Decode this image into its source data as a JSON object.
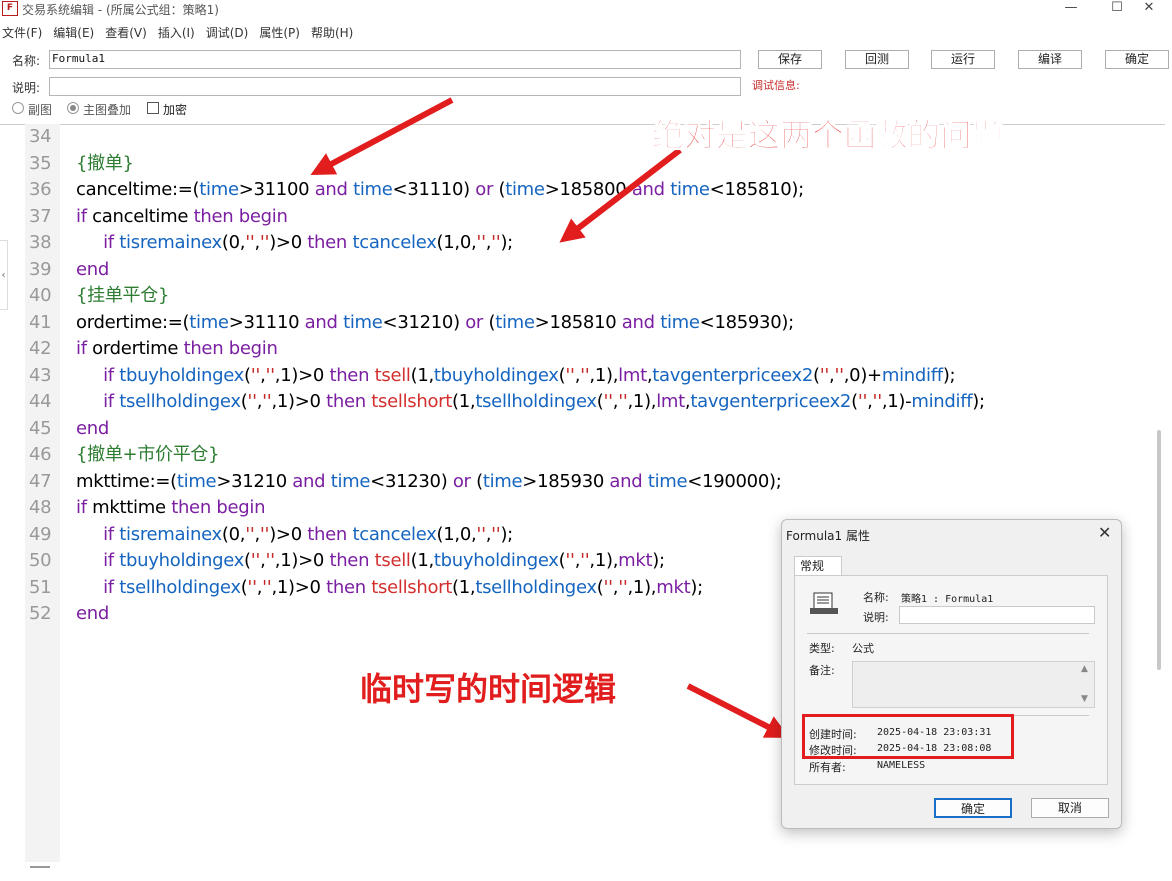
{
  "window": {
    "title": "交易系统编辑 - (所属公式组：策略1)",
    "icon_text": "F",
    "minimize": "—",
    "maximize": "☐",
    "close": "✕"
  },
  "menu": [
    "文件(F)",
    "编辑(E)",
    "查看(V)",
    "插入(I)",
    "调试(D)",
    "属性(P)",
    "帮助(H)"
  ],
  "form": {
    "name_label": "名称:",
    "name_value": "Formula1",
    "desc_label": "说明:",
    "desc_value": "",
    "debug_label": "调试信息:"
  },
  "toolbar": [
    "保存",
    "回测",
    "运行",
    "编译",
    "确定"
  ],
  "options": {
    "sub_chart": "副图",
    "main_overlay": "主图叠加",
    "encrypt": "加密",
    "selected": "主图叠加"
  },
  "code_lines": [
    {
      "num": "34",
      "segs": []
    },
    {
      "num": "35",
      "segs": [
        {
          "t": "{撤单}",
          "c": "gr"
        }
      ]
    },
    {
      "num": "36",
      "segs": [
        {
          "t": "canceltime:=("
        },
        {
          "t": "time",
          "c": "fn"
        },
        {
          "t": ">31100 "
        },
        {
          "t": "and",
          "c": "kw"
        },
        {
          "t": " "
        },
        {
          "t": "time",
          "c": "fn"
        },
        {
          "t": "<31110) "
        },
        {
          "t": "or",
          "c": "kw"
        },
        {
          "t": " ("
        },
        {
          "t": "time",
          "c": "fn"
        },
        {
          "t": ">185800 "
        },
        {
          "t": "and",
          "c": "kw"
        },
        {
          "t": " "
        },
        {
          "t": "time",
          "c": "fn"
        },
        {
          "t": "<185810);"
        }
      ]
    },
    {
      "num": "37",
      "segs": [
        {
          "t": "if",
          "c": "kw"
        },
        {
          "t": " canceltime "
        },
        {
          "t": "then begin",
          "c": "kw"
        }
      ]
    },
    {
      "num": "38",
      "segs": [
        {
          "t": "     "
        },
        {
          "t": "if",
          "c": "kw"
        },
        {
          "t": " "
        },
        {
          "t": "tisremainex",
          "c": "fn"
        },
        {
          "t": "(0,"
        },
        {
          "t": "''",
          "c": "st"
        },
        {
          "t": ","
        },
        {
          "t": "''",
          "c": "st"
        },
        {
          "t": ")>0 "
        },
        {
          "t": "then",
          "c": "kw"
        },
        {
          "t": " "
        },
        {
          "t": "tcancelex",
          "c": "fn"
        },
        {
          "t": "(1,0,"
        },
        {
          "t": "''",
          "c": "st"
        },
        {
          "t": ","
        },
        {
          "t": "''",
          "c": "st"
        },
        {
          "t": ");"
        }
      ]
    },
    {
      "num": "39",
      "segs": [
        {
          "t": "end",
          "c": "kw"
        }
      ]
    },
    {
      "num": "40",
      "segs": [
        {
          "t": "{挂单平仓}",
          "c": "gr"
        }
      ]
    },
    {
      "num": "41",
      "segs": [
        {
          "t": "ordertime:=("
        },
        {
          "t": "time",
          "c": "fn"
        },
        {
          "t": ">31110 "
        },
        {
          "t": "and",
          "c": "kw"
        },
        {
          "t": " "
        },
        {
          "t": "time",
          "c": "fn"
        },
        {
          "t": "<31210) "
        },
        {
          "t": "or",
          "c": "kw"
        },
        {
          "t": " ("
        },
        {
          "t": "time",
          "c": "fn"
        },
        {
          "t": ">185810 "
        },
        {
          "t": "and",
          "c": "kw"
        },
        {
          "t": " "
        },
        {
          "t": "time",
          "c": "fn"
        },
        {
          "t": "<185930);"
        }
      ]
    },
    {
      "num": "42",
      "segs": [
        {
          "t": "if",
          "c": "kw"
        },
        {
          "t": " ordertime "
        },
        {
          "t": "then begin",
          "c": "kw"
        }
      ]
    },
    {
      "num": "43",
      "segs": [
        {
          "t": "     "
        },
        {
          "t": "if",
          "c": "kw"
        },
        {
          "t": " "
        },
        {
          "t": "tbuyholdingex",
          "c": "fn"
        },
        {
          "t": "("
        },
        {
          "t": "''",
          "c": "st"
        },
        {
          "t": ","
        },
        {
          "t": "''",
          "c": "st"
        },
        {
          "t": ",1)>0 "
        },
        {
          "t": "then",
          "c": "kw"
        },
        {
          "t": " "
        },
        {
          "t": "tsell",
          "c": "rd"
        },
        {
          "t": "(1,"
        },
        {
          "t": "tbuyholdingex",
          "c": "fn"
        },
        {
          "t": "("
        },
        {
          "t": "''",
          "c": "st"
        },
        {
          "t": ","
        },
        {
          "t": "''",
          "c": "st"
        },
        {
          "t": ",1),"
        },
        {
          "t": "lmt",
          "c": "kw"
        },
        {
          "t": ","
        },
        {
          "t": "tavgenterpriceex2",
          "c": "fn"
        },
        {
          "t": "("
        },
        {
          "t": "''",
          "c": "st"
        },
        {
          "t": ","
        },
        {
          "t": "''",
          "c": "st"
        },
        {
          "t": ",0)+"
        },
        {
          "t": "mindiff",
          "c": "fn"
        },
        {
          "t": ");"
        }
      ]
    },
    {
      "num": "44",
      "segs": [
        {
          "t": "     "
        },
        {
          "t": "if",
          "c": "kw"
        },
        {
          "t": " "
        },
        {
          "t": "tsellholdingex",
          "c": "fn"
        },
        {
          "t": "("
        },
        {
          "t": "''",
          "c": "st"
        },
        {
          "t": ","
        },
        {
          "t": "''",
          "c": "st"
        },
        {
          "t": ",1)>0 "
        },
        {
          "t": "then",
          "c": "kw"
        },
        {
          "t": " "
        },
        {
          "t": "tsellshort",
          "c": "rd"
        },
        {
          "t": "(1,"
        },
        {
          "t": "tsellholdingex",
          "c": "fn"
        },
        {
          "t": "("
        },
        {
          "t": "''",
          "c": "st"
        },
        {
          "t": ","
        },
        {
          "t": "''",
          "c": "st"
        },
        {
          "t": ",1),"
        },
        {
          "t": "lmt",
          "c": "kw"
        },
        {
          "t": ","
        },
        {
          "t": "tavgenterpriceex2",
          "c": "fn"
        },
        {
          "t": "("
        },
        {
          "t": "''",
          "c": "st"
        },
        {
          "t": ","
        },
        {
          "t": "''",
          "c": "st"
        },
        {
          "t": ",1)-"
        },
        {
          "t": "mindiff",
          "c": "fn"
        },
        {
          "t": ");"
        }
      ]
    },
    {
      "num": "45",
      "segs": [
        {
          "t": "end",
          "c": "kw"
        }
      ]
    },
    {
      "num": "46",
      "segs": [
        {
          "t": "{撤单+市价平仓}",
          "c": "gr"
        }
      ]
    },
    {
      "num": "47",
      "segs": [
        {
          "t": "mkttime:=("
        },
        {
          "t": "time",
          "c": "fn"
        },
        {
          "t": ">31210 "
        },
        {
          "t": "and",
          "c": "kw"
        },
        {
          "t": " "
        },
        {
          "t": "time",
          "c": "fn"
        },
        {
          "t": "<31230) "
        },
        {
          "t": "or",
          "c": "kw"
        },
        {
          "t": " ("
        },
        {
          "t": "time",
          "c": "fn"
        },
        {
          "t": ">185930 "
        },
        {
          "t": "and",
          "c": "kw"
        },
        {
          "t": " "
        },
        {
          "t": "time",
          "c": "fn"
        },
        {
          "t": "<190000);"
        }
      ]
    },
    {
      "num": "48",
      "segs": [
        {
          "t": "if",
          "c": "kw"
        },
        {
          "t": " mkttime "
        },
        {
          "t": "then begin",
          "c": "kw"
        }
      ]
    },
    {
      "num": "49",
      "segs": [
        {
          "t": "     "
        },
        {
          "t": "if",
          "c": "kw"
        },
        {
          "t": " "
        },
        {
          "t": "tisremainex",
          "c": "fn"
        },
        {
          "t": "(0,"
        },
        {
          "t": "''",
          "c": "st"
        },
        {
          "t": ","
        },
        {
          "t": "''",
          "c": "st"
        },
        {
          "t": ")>0 "
        },
        {
          "t": "then",
          "c": "kw"
        },
        {
          "t": " "
        },
        {
          "t": "tcancelex",
          "c": "fn"
        },
        {
          "t": "(1,0,"
        },
        {
          "t": "''",
          "c": "st"
        },
        {
          "t": ","
        },
        {
          "t": "''",
          "c": "st"
        },
        {
          "t": ");"
        }
      ]
    },
    {
      "num": "50",
      "segs": [
        {
          "t": "     "
        },
        {
          "t": "if",
          "c": "kw"
        },
        {
          "t": " "
        },
        {
          "t": "tbuyholdingex",
          "c": "fn"
        },
        {
          "t": "("
        },
        {
          "t": "''",
          "c": "st"
        },
        {
          "t": ","
        },
        {
          "t": "''",
          "c": "st"
        },
        {
          "t": ",1)>0 "
        },
        {
          "t": "then",
          "c": "kw"
        },
        {
          "t": " "
        },
        {
          "t": "tsell",
          "c": "rd"
        },
        {
          "t": "(1,"
        },
        {
          "t": "tbuyholdingex",
          "c": "fn"
        },
        {
          "t": "("
        },
        {
          "t": "''",
          "c": "st"
        },
        {
          "t": ","
        },
        {
          "t": "''",
          "c": "st"
        },
        {
          "t": ",1),"
        },
        {
          "t": "mkt",
          "c": "kw"
        },
        {
          "t": ");"
        }
      ]
    },
    {
      "num": "51",
      "segs": [
        {
          "t": "     "
        },
        {
          "t": "if",
          "c": "kw"
        },
        {
          "t": " "
        },
        {
          "t": "tsellholdingex",
          "c": "fn"
        },
        {
          "t": "("
        },
        {
          "t": "''",
          "c": "st"
        },
        {
          "t": ","
        },
        {
          "t": "''",
          "c": "st"
        },
        {
          "t": ",1)>0 "
        },
        {
          "t": "then",
          "c": "kw"
        },
        {
          "t": " "
        },
        {
          "t": "tsellshort",
          "c": "rd"
        },
        {
          "t": "(1,"
        },
        {
          "t": "tsellholdingex",
          "c": "fn"
        },
        {
          "t": "("
        },
        {
          "t": "''",
          "c": "st"
        },
        {
          "t": ","
        },
        {
          "t": "''",
          "c": "st"
        },
        {
          "t": ",1),"
        },
        {
          "t": "mkt",
          "c": "kw"
        },
        {
          "t": ");"
        }
      ]
    },
    {
      "num": "52",
      "segs": [
        {
          "t": "end",
          "c": "kw"
        }
      ]
    }
  ],
  "annotations": {
    "top": "绝对是这两个函数的问题",
    "bottom": "临时写的时间逻辑"
  },
  "dialog": {
    "title": "Formula1 属性",
    "close": "✕",
    "tab": "常规",
    "name_label": "名称:",
    "name_value": "策略1 : Formula1",
    "desc_label": "说明:",
    "type_label": "类型:",
    "type_value": "公式",
    "notes_label": "备注:",
    "created_label": "创建时间:",
    "created_value": "2025-04-18 23:03:31",
    "modified_label": "修改时间:",
    "modified_value": "2025-04-18 23:08:08",
    "owner_label": "所有者:",
    "owner_value": "NAMELESS",
    "ok": "确定",
    "cancel": "取消"
  },
  "colors": {
    "annotation_red": "#e11d1d",
    "keyword_purple": "#7b1fa2",
    "function_blue": "#1565c0",
    "comment_green": "#2e7d32"
  }
}
